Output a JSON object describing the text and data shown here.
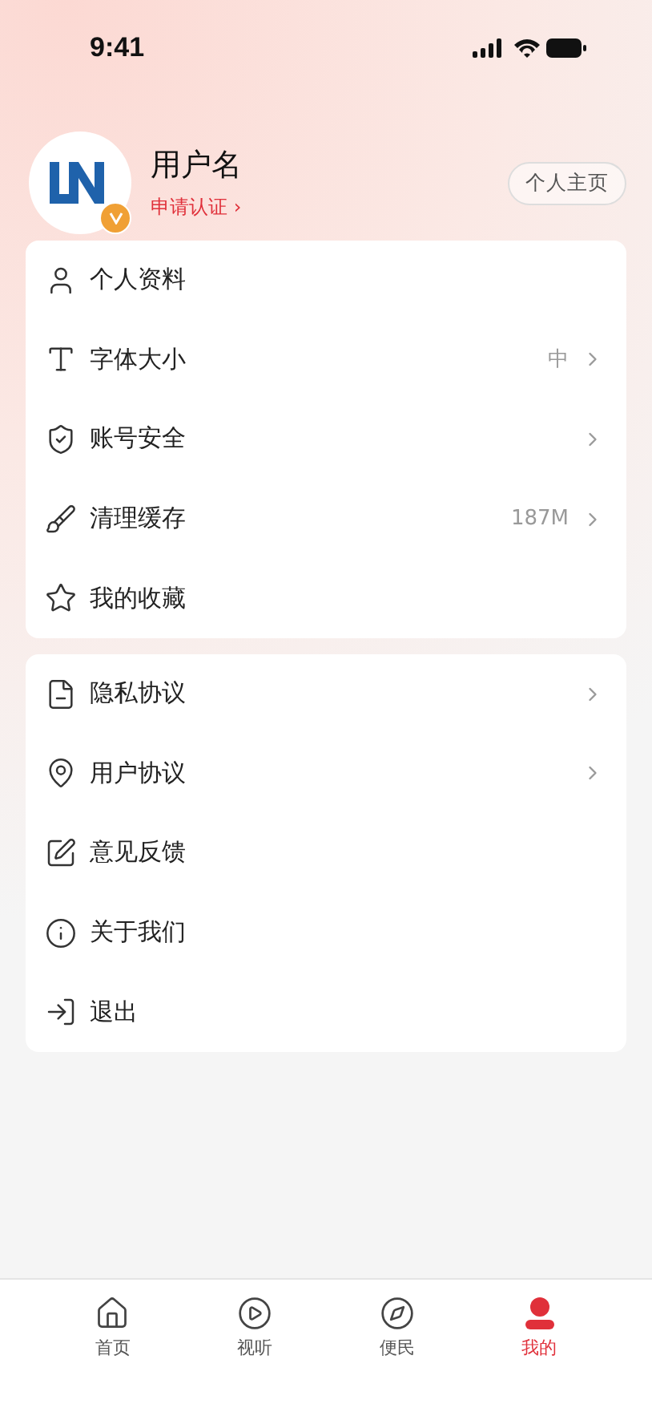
{
  "status_bar": {
    "time": "9:41"
  },
  "profile": {
    "username": "用户名",
    "verify_link": "申请认证 ›",
    "homepage_button": "个人主页",
    "verified": true
  },
  "menu_groups": [
    {
      "items": [
        {
          "label": "个人资料",
          "chevron": false
        },
        {
          "label": "字体大小",
          "value": "中",
          "chevron": true
        },
        {
          "label": "账号安全",
          "chevron": true
        },
        {
          "label": "清理缓存",
          "value": "187M",
          "chevron": true
        },
        {
          "label": "我的收藏",
          "chevron": false
        }
      ]
    },
    {
      "items": [
        {
          "label": "隐私协议",
          "chevron": true
        },
        {
          "label": "用户协议",
          "chevron": true
        },
        {
          "label": "意见反馈",
          "chevron": false
        },
        {
          "label": "关于我们",
          "chevron": false
        },
        {
          "label": "退出",
          "chevron": false
        }
      ]
    }
  ],
  "tab_bar": [
    {
      "label": "首页",
      "selected": false
    },
    {
      "label": "视听",
      "selected": false
    },
    {
      "label": "便民",
      "selected": false
    },
    {
      "label": "我的",
      "selected": true
    }
  ]
}
